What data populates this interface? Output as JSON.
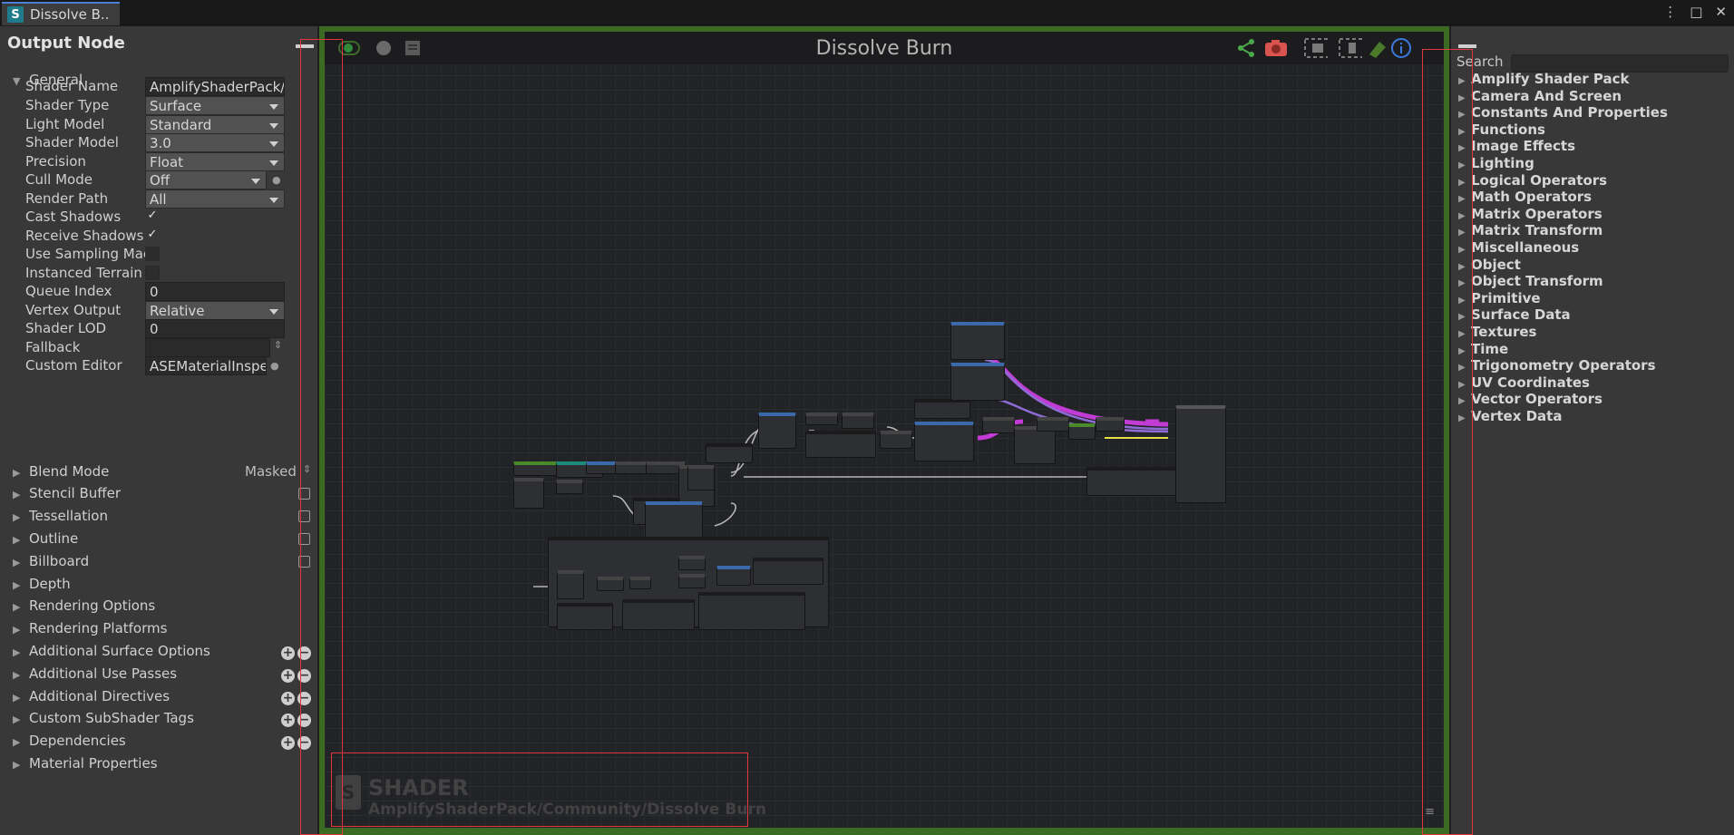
{
  "tab": {
    "icon_letter": "S",
    "label": "Dissolve B.."
  },
  "window_controls": {
    "menu": "⋮",
    "maximize": "□",
    "close": "✕"
  },
  "inspector": {
    "title": "Output Node",
    "general": "General",
    "rows": [
      {
        "label": "Shader Name",
        "value": "AmplifyShaderPack/Com"
      },
      {
        "label": "Shader Type",
        "value": "Surface"
      },
      {
        "label": "Light Model",
        "value": "Standard"
      },
      {
        "label": "Shader Model",
        "value": "3.0"
      },
      {
        "label": "Precision",
        "value": "Float"
      },
      {
        "label": "Cull Mode",
        "value": "Off"
      },
      {
        "label": "Render Path",
        "value": "All"
      },
      {
        "label": "Cast Shadows",
        "value": "✓"
      },
      {
        "label": "Receive Shadows",
        "value": "✓"
      },
      {
        "label": "Use Sampling Mac",
        "value": ""
      },
      {
        "label": "Instanced Terrain",
        "value": ""
      },
      {
        "label": "Queue Index",
        "value": "0"
      },
      {
        "label": "Vertex Output",
        "value": "Relative"
      },
      {
        "label": "Shader LOD",
        "value": "0"
      },
      {
        "label": "Fallback",
        "value": ""
      },
      {
        "label": "Custom Editor",
        "value": "ASEMaterialInspector"
      }
    ],
    "sections": [
      "Blend Mode",
      "Stencil Buffer",
      "Tessellation",
      "Outline",
      "Billboard",
      "Depth",
      "Rendering Options",
      "Rendering Platforms",
      "Additional Surface Options",
      "Additional Use Passes",
      "Additional Directives",
      "Custom SubShader Tags",
      "Dependencies",
      "Material Properties"
    ],
    "blend_mode_value": "Masked",
    "plus": "+",
    "minus": "−"
  },
  "canvas": {
    "title": "Dissolve Burn",
    "watermark_title": "SHADER",
    "watermark_path": "AmplifyShaderPack/Community/Dissolve Burn",
    "accent_green": "#3b6a22",
    "wire_purple": "#c23bd4"
  },
  "palette": {
    "search_label": "Search",
    "search_value": "",
    "categories": [
      "Amplify Shader Pack",
      "Camera And Screen",
      "Constants And Properties",
      "Functions",
      "Image Effects",
      "Lighting",
      "Logical Operators",
      "Math Operators",
      "Matrix Operators",
      "Matrix Transform",
      "Miscellaneous",
      "Object",
      "Object Transform",
      "Primitive",
      "Surface Data",
      "Textures",
      "Time",
      "Trigonometry Operators",
      "UV Coordinates",
      "Vector Operators",
      "Vertex Data"
    ]
  }
}
